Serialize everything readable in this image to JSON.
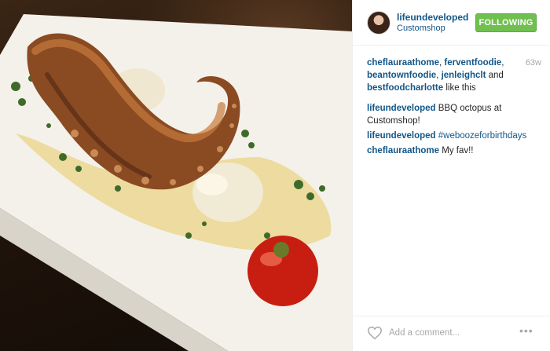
{
  "photo": {
    "alt": "Grilled octopus tentacle with potato, herb oil and roasted tomato on a white plate"
  },
  "header": {
    "username": "lifeundeveloped",
    "location": "Customshop",
    "follow_label": "FOLLOWING"
  },
  "likes": {
    "users": [
      "cheflauraathome",
      "ferventfoodie",
      "beantownfoodie",
      "jenleighclt",
      "bestfoodcharlotte"
    ],
    "suffix": "like this",
    "time": "63w"
  },
  "comments": [
    {
      "user": "lifeundeveloped",
      "text": "BBQ octopus at Customshop!"
    },
    {
      "user": "lifeundeveloped",
      "text": "#weboozeforbirthdays"
    },
    {
      "user": "cheflauraathome",
      "text": "My fav!!"
    }
  ],
  "footer": {
    "comment_placeholder": "Add a comment...",
    "more_label": "•••"
  },
  "colors": {
    "link": "#125688",
    "follow_green": "#70c050",
    "muted": "#a5a7aa"
  }
}
